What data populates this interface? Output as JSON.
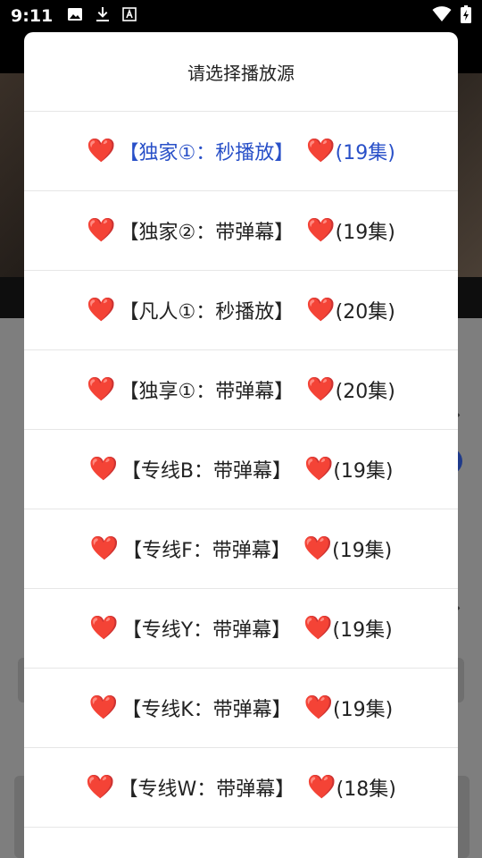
{
  "status_bar": {
    "time": "9:11",
    "icons": [
      "image-icon",
      "download-icon",
      "font-icon"
    ],
    "right_icons": [
      "wifi-icon",
      "battery-icon"
    ]
  },
  "dialog": {
    "title": "请选择播放源",
    "heart_glyph": "❤️",
    "items": [
      {
        "name": "【独家①：秒播放】",
        "count": "(19集)",
        "selected": true
      },
      {
        "name": "【独家②：带弹幕】",
        "count": "(19集)",
        "selected": false
      },
      {
        "name": "【凡人①：秒播放】",
        "count": "(20集)",
        "selected": false
      },
      {
        "name": "【独享①：带弹幕】",
        "count": "(20集)",
        "selected": false
      },
      {
        "name": "【专线B：带弹幕】",
        "count": "(19集)",
        "selected": false
      },
      {
        "name": "【专线F：带弹幕】",
        "count": "(19集)",
        "selected": false
      },
      {
        "name": "【专线Y：带弹幕】",
        "count": "(19集)",
        "selected": false
      },
      {
        "name": "【专线K：带弹幕】",
        "count": "(19集)",
        "selected": false
      },
      {
        "name": "【专线W：带弹幕】",
        "count": "(18集)",
        "selected": false
      }
    ]
  },
  "colors": {
    "selected": "#2950c8",
    "heart": "#e01b24"
  }
}
